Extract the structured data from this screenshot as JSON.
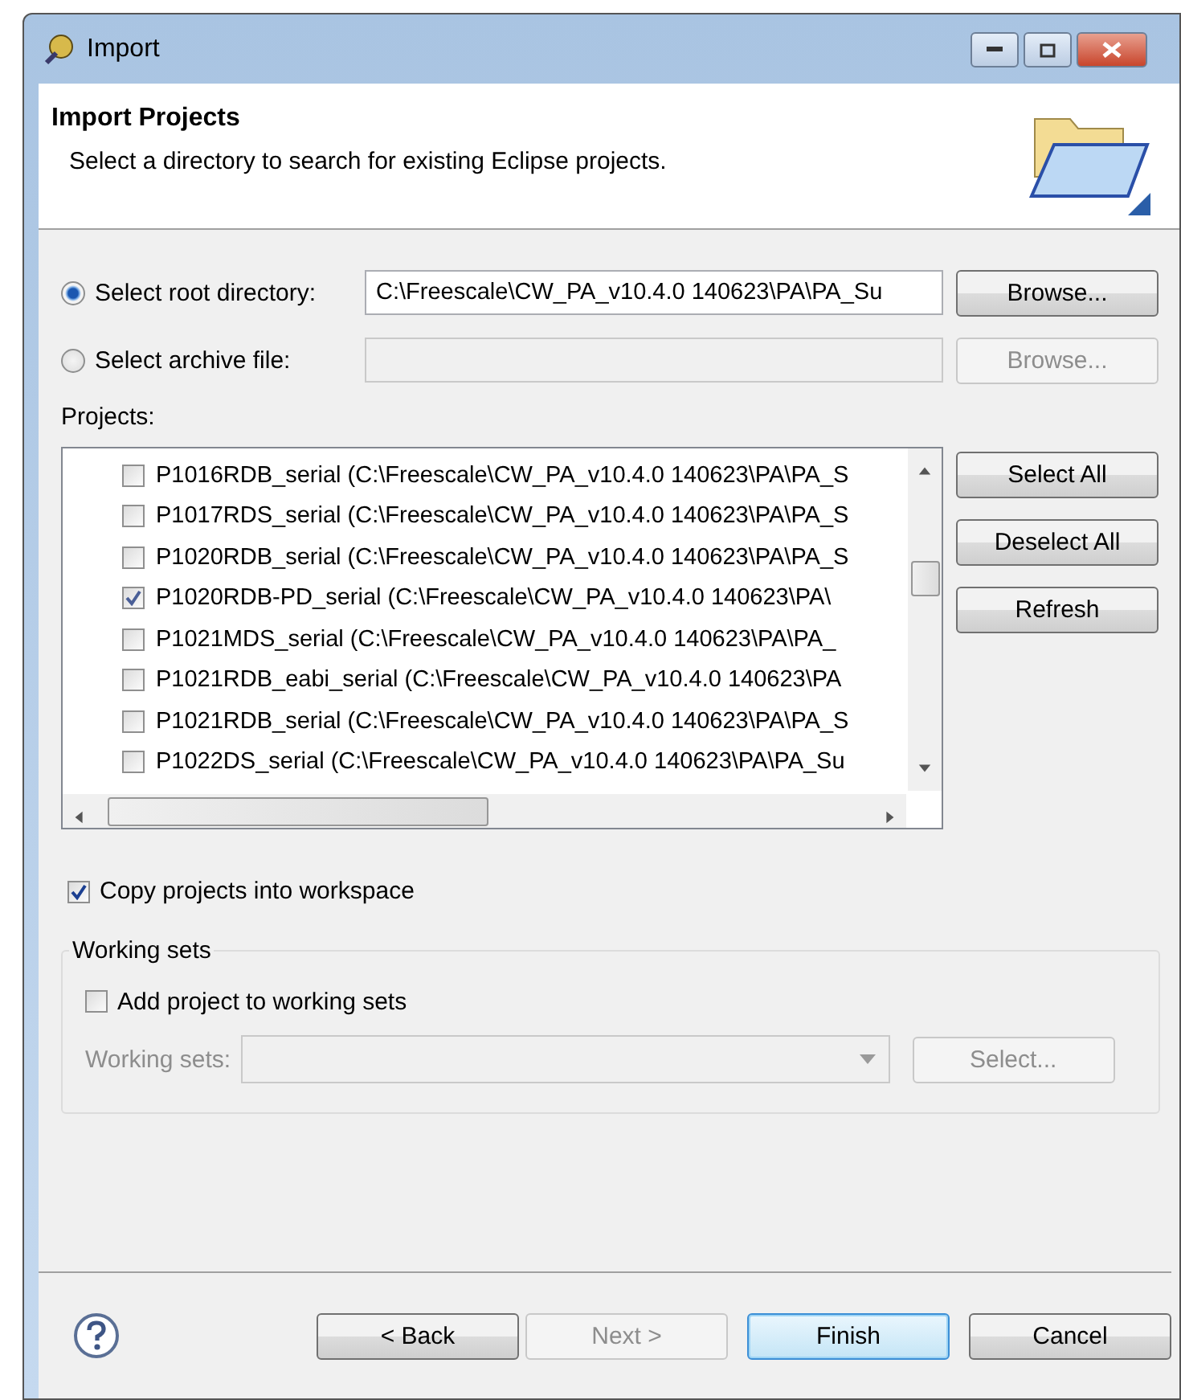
{
  "window": {
    "title": "Import"
  },
  "header": {
    "title": "Import Projects",
    "description": "Select a directory to search for existing Eclipse projects."
  },
  "source_options": [
    {
      "label": "Select root directory:",
      "selected": true,
      "path": "C:\\Freescale\\CW_PA_v10.4.0 140623\\PA\\PA_Su",
      "browse": "Browse..."
    },
    {
      "label": "Select archive file:",
      "selected": false,
      "browse": "Browse..."
    }
  ],
  "projects": {
    "label": "Projects:",
    "items": [
      {
        "label": "P1016RDB_serial (C:\\Freescale\\CW_PA_v10.4.0 140623\\PA\\PA_S",
        "checked": false
      },
      {
        "label": "P1017RDS_serial (C:\\Freescale\\CW_PA_v10.4.0 140623\\PA\\PA_S",
        "checked": false
      },
      {
        "label": "P1020RDB_serial (C:\\Freescale\\CW_PA_v10.4.0 140623\\PA\\PA_S",
        "checked": false
      },
      {
        "label": "P1020RDB-PD_serial (C:\\Freescale\\CW_PA_v10.4.0 140623\\PA\\",
        "checked": true
      },
      {
        "label": "P1021MDS_serial (C:\\Freescale\\CW_PA_v10.4.0 140623\\PA\\PA_",
        "checked": false
      },
      {
        "label": "P1021RDB_eabi_serial (C:\\Freescale\\CW_PA_v10.4.0 140623\\PA",
        "checked": false
      },
      {
        "label": "P1021RDB_serial (C:\\Freescale\\CW_PA_v10.4.0 140623\\PA\\PA_S",
        "checked": false
      },
      {
        "label": "P1022DS_serial (C:\\Freescale\\CW_PA_v10.4.0 140623\\PA\\PA_Su",
        "checked": false
      }
    ],
    "buttons": [
      "Select All",
      "Deselect All",
      "Refresh"
    ]
  },
  "copy_option": {
    "label": "Copy projects into workspace",
    "checked": true
  },
  "working_sets": {
    "title": "Working sets",
    "add": {
      "label": "Add project to working sets",
      "checked": false
    },
    "field_label": "Working sets:",
    "select": "Select..."
  },
  "footer_buttons": [
    {
      "label": "< Back",
      "disabled": false,
      "default": false
    },
    {
      "label": "Next >",
      "disabled": true,
      "default": false
    },
    {
      "label": "Finish",
      "disabled": false,
      "default": true
    },
    {
      "label": "Cancel",
      "disabled": false,
      "default": false
    }
  ]
}
